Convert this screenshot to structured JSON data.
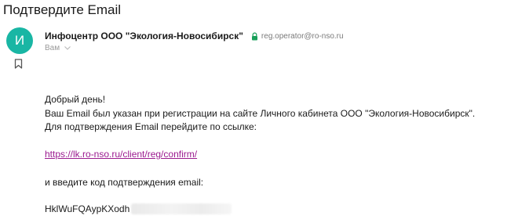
{
  "email": {
    "subject": "Подтвердите Email",
    "sender": {
      "avatar_letter": "И",
      "avatar_color": "#19b6a4",
      "name": "Инфоцентр ООО \"Экология-Новосибирск\"",
      "address": "reg.operator@ro-nso.ru",
      "verified_icon": "lock-icon"
    },
    "recipient_label": "Вам",
    "body": {
      "greeting": "Добрый день!",
      "line1": "Ваш Email был указан при регистрации на сайте Личного кабинета ООО \"Экология-Новосибирск\".",
      "line2": "Для подтверждения Email перейдите по ссылке:",
      "link": "https://lk.ro-nso.ru/client/reg/confirm/",
      "link_color": "#9b1a8f",
      "line3": "и введите код подтверждения email:",
      "code_visible": "HklWuFQAypKXodh"
    }
  }
}
